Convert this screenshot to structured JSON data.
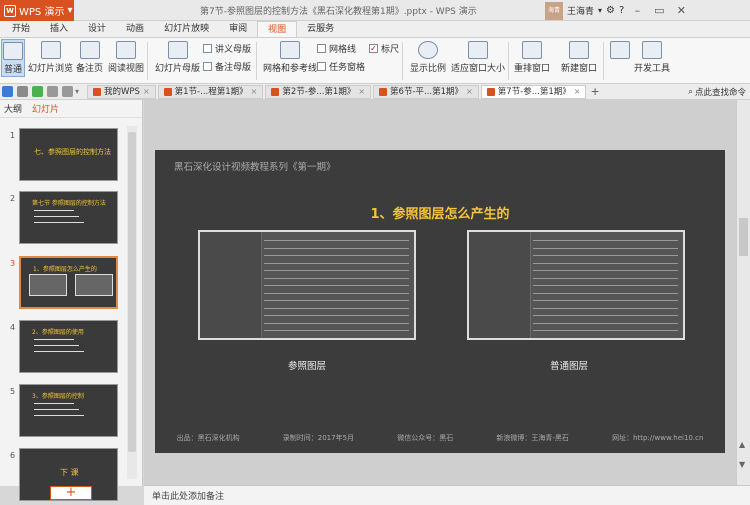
{
  "app": {
    "name": "WPS 演示",
    "doc_title": "第7节-参照图层的控制方法《黑石深化教程第1期》.pptx - WPS 演示",
    "user": "王海青",
    "avatar_text": "海青"
  },
  "colors": {
    "accent": "#d9511f",
    "slide_bg": "#3c3c3c",
    "heading": "#f5c43a"
  },
  "menu_tabs": [
    "开始",
    "插入",
    "设计",
    "动画",
    "幻灯片放映",
    "审阅",
    "视图",
    "云服务"
  ],
  "active_menu": "视图",
  "ribbon": {
    "normal": "普通",
    "slide_browse": "幻灯片浏览",
    "notes_page": "备注页",
    "reading_view": "阅读视图",
    "slide_master": "幻灯片母版",
    "handout_master": "讲义母版",
    "notes_master": "备注母版",
    "grid_guides": "网格和参考线",
    "gridlines": "网格线",
    "ruler": "标尺",
    "task_pane": "任务窗格",
    "zoom": "显示比例",
    "fit_window": "适应窗口大小",
    "arrange": "重排窗口",
    "new_window": "新建窗口",
    "dev_tools": "开发工具"
  },
  "doc_tabs": [
    {
      "label": "我的WPS",
      "active": false
    },
    {
      "label": "第1节-...程第1期》",
      "active": false
    },
    {
      "label": "第2节-参...第1期》",
      "active": false
    },
    {
      "label": "第6节-平...第1期》",
      "active": false
    },
    {
      "label": "第7节-参...第1期》",
      "active": true
    }
  ],
  "search_placeholder": "点此查找命令",
  "panel_tabs": {
    "outline": "大纲",
    "slides": "幻灯片"
  },
  "thumbnails": [
    {
      "num": "1",
      "text": "七、参照图层的控制方法"
    },
    {
      "num": "2",
      "text": "第七节  参照图层的控制方法"
    },
    {
      "num": "3",
      "text": "1、参照图层怎么产生的"
    },
    {
      "num": "4",
      "text": "2、参照图层的使用"
    },
    {
      "num": "5",
      "text": "3、参照图层的控制"
    },
    {
      "num": "6",
      "text": "下  课"
    }
  ],
  "slide": {
    "series": "黑石深化设计视频教程系列《第一期》",
    "heading": "1、参照图层怎么产生的",
    "caption_left": "参照图层",
    "caption_right": "普通图层",
    "footer": [
      "出品：黑石深化机构",
      "录制时间：2017年5月",
      "微信公众号：黑石",
      "新浪微博：王海青-黑石",
      "网址：http://www.hei10.cn"
    ]
  },
  "notes_placeholder": "单击此处添加备注"
}
